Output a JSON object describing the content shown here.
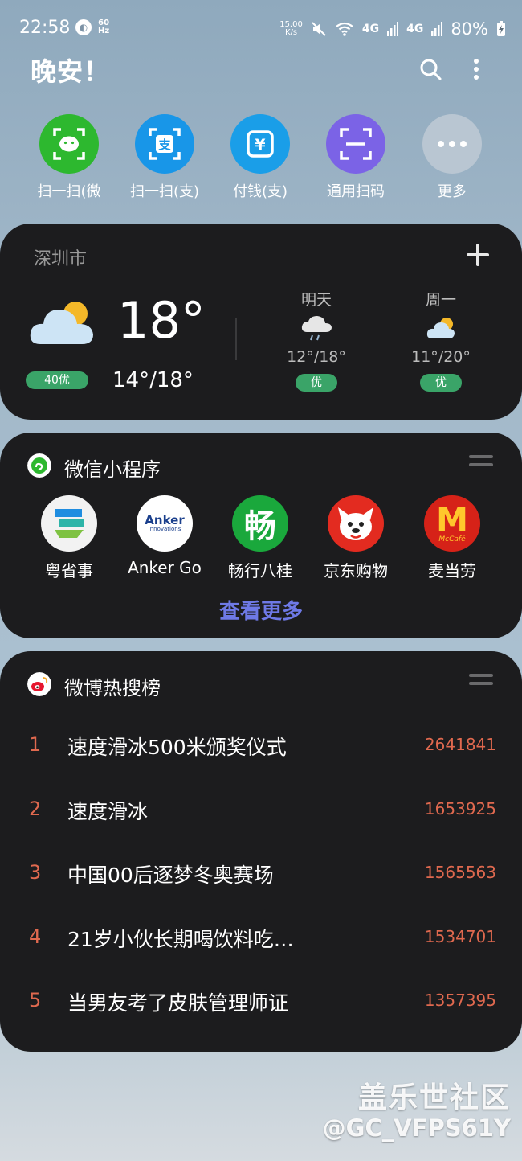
{
  "status_bar": {
    "time": "22:58",
    "refresh_rate": "60",
    "refresh_unit": "Hz",
    "net_speed": "15.00",
    "net_unit": "K/s",
    "signal_labels": [
      "4G",
      "4G"
    ],
    "battery": "80%"
  },
  "header": {
    "greeting": "晚安！"
  },
  "quick_actions": [
    {
      "label": "扫一扫(微",
      "color": "#2db82f"
    },
    {
      "label": "扫一扫(支)",
      "color": "#1896e8"
    },
    {
      "label": "付钱(支)",
      "color": "#1a9ee8"
    },
    {
      "label": "通用扫码",
      "color": "#7b63e6"
    },
    {
      "label": "更多",
      "color": "#b9c6d2"
    }
  ],
  "weather": {
    "city": "深圳市",
    "current_temp": "18°",
    "today_range": "14°/18°",
    "aqi": "40优",
    "forecast": [
      {
        "day": "明天",
        "temp": "12°/18°",
        "quality": "优",
        "icon": "rain-cloud-icon"
      },
      {
        "day": "周一",
        "temp": "11°/20°",
        "quality": "优",
        "icon": "partly-cloudy-icon"
      }
    ]
  },
  "mini_programs": {
    "title": "微信小程序",
    "apps": [
      {
        "label": "粤省事",
        "icon": "yueshengshi-icon"
      },
      {
        "label": "Anker Go",
        "icon": "anker-icon",
        "logo_text": "Anker",
        "logo_sub": "Innovations"
      },
      {
        "label": "畅行八桂",
        "icon": "changxing-icon",
        "logo_text": "畅"
      },
      {
        "label": "京东购物",
        "icon": "jd-icon"
      },
      {
        "label": "麦当劳",
        "icon": "mcdonalds-icon",
        "logo_text": "M",
        "logo_sub": "McCafé"
      }
    ],
    "more_label": "查看更多"
  },
  "weibo": {
    "title": "微博热搜榜",
    "items": [
      {
        "rank": "1",
        "title": "速度滑冰500米颁奖仪式",
        "count": "2641841"
      },
      {
        "rank": "2",
        "title": "速度滑冰",
        "count": "1653925"
      },
      {
        "rank": "3",
        "title": "中国00后逐梦冬奥赛场",
        "count": "1565563"
      },
      {
        "rank": "4",
        "title": "21岁小伙长期喝饮料吃…",
        "count": "1534701"
      },
      {
        "rank": "5",
        "title": "当男友考了皮肤管理师证",
        "count": "1357395"
      }
    ]
  },
  "watermark": {
    "line1": "盖乐世社区",
    "line2": "@GC_VFPS61Y"
  }
}
